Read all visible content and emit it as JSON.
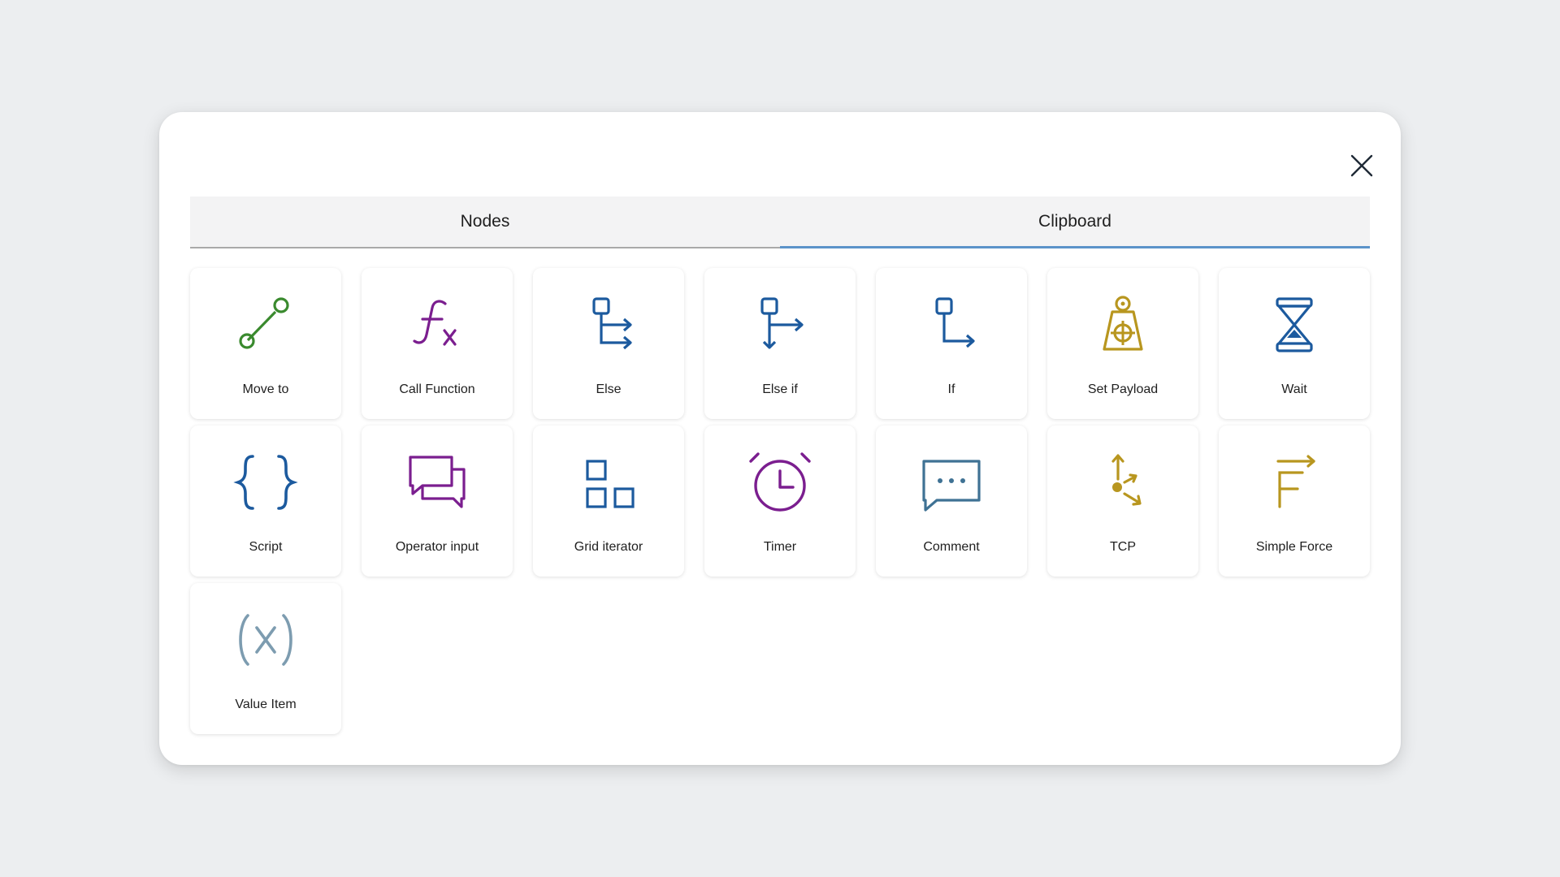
{
  "tabs": {
    "nodes": "Nodes",
    "clipboard": "Clipboard"
  },
  "nodes": [
    {
      "label": "Move to",
      "icon": "move-to-icon",
      "color": "#3a8a2e"
    },
    {
      "label": "Call Function",
      "icon": "function-icon",
      "color": "#7b1e8f"
    },
    {
      "label": "Else",
      "icon": "else-branch-icon",
      "color": "#1c5a9e"
    },
    {
      "label": "Else if",
      "icon": "else-if-branch-icon",
      "color": "#1c5a9e"
    },
    {
      "label": "If",
      "icon": "if-branch-icon",
      "color": "#1c5a9e"
    },
    {
      "label": "Set Payload",
      "icon": "payload-weight-icon",
      "color": "#b8961f"
    },
    {
      "label": "Wait",
      "icon": "hourglass-icon",
      "color": "#1c5a9e"
    },
    {
      "label": "Script",
      "icon": "curly-braces-icon",
      "color": "#1c5a9e"
    },
    {
      "label": "Operator input",
      "icon": "chat-bubbles-icon",
      "color": "#7b1e8f"
    },
    {
      "label": "Grid iterator",
      "icon": "grid-squares-icon",
      "color": "#1c5a9e"
    },
    {
      "label": "Timer",
      "icon": "alarm-clock-icon",
      "color": "#7b1e8f"
    },
    {
      "label": "Comment",
      "icon": "comment-bubble-icon",
      "color": "#3f7294"
    },
    {
      "label": "TCP",
      "icon": "tcp-axes-icon",
      "color": "#b8961f"
    },
    {
      "label": "Simple Force",
      "icon": "force-icon",
      "color": "#b8961f"
    },
    {
      "label": "Value Item",
      "icon": "variable-icon",
      "color": "#7d9cb0"
    }
  ]
}
